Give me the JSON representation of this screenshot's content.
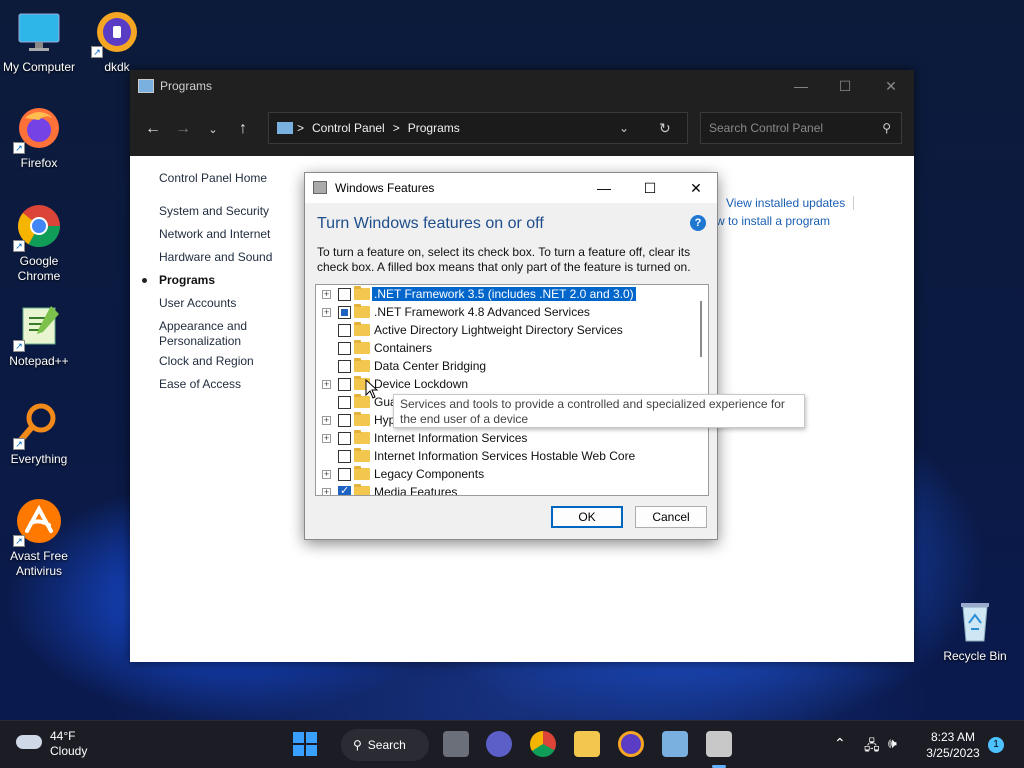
{
  "desktop": {
    "icons": [
      {
        "label": "My Computer",
        "icon": "monitor-icon"
      },
      {
        "label": "dkdk",
        "icon": "avast-secure-browser-icon"
      },
      {
        "label": "Firefox",
        "icon": "firefox-icon"
      },
      {
        "label": "Google Chrome",
        "icon": "chrome-icon"
      },
      {
        "label": "Notepad++",
        "icon": "notepadpp-icon"
      },
      {
        "label": "Everything",
        "icon": "everything-search-icon"
      },
      {
        "label": "Avast Free Antivirus",
        "icon": "avast-icon"
      },
      {
        "label": "Recycle Bin",
        "icon": "recycle-bin-icon"
      }
    ]
  },
  "control_panel": {
    "title": "Programs",
    "address": {
      "crumbs": [
        "Control Panel",
        "Programs"
      ],
      "separator": ">"
    },
    "search_placeholder": "Search Control Panel",
    "sidebar": {
      "home": "Control Panel Home",
      "items": [
        {
          "label": "System and Security"
        },
        {
          "label": "Network and Internet"
        },
        {
          "label": "Hardware and Sound"
        },
        {
          "label": "Programs",
          "active": true
        },
        {
          "label": "User Accounts"
        },
        {
          "label": "Appearance and Personalization"
        },
        {
          "label": "Clock and Region"
        },
        {
          "label": "Ease of Access"
        }
      ]
    },
    "links": {
      "view_updates": "View installed updates",
      "how_to_install": "w to install a program"
    }
  },
  "windows_features": {
    "title": "Windows Features",
    "heading": "Turn Windows features on or off",
    "description": "To turn a feature on, select its check box. To turn a feature off, clear its check box. A filled box means that only part of the feature is turned on.",
    "features": [
      {
        "label": ".NET Framework 3.5 (includes .NET 2.0 and 3.0)",
        "expandable": true,
        "state": "unchecked",
        "selected": true
      },
      {
        "label": ".NET Framework 4.8 Advanced Services",
        "expandable": true,
        "state": "partial"
      },
      {
        "label": "Active Directory Lightweight Directory Services",
        "expandable": false,
        "state": "unchecked"
      },
      {
        "label": "Containers",
        "expandable": false,
        "state": "unchecked"
      },
      {
        "label": "Data Center Bridging",
        "expandable": false,
        "state": "unchecked"
      },
      {
        "label": "Device Lockdown",
        "expandable": true,
        "state": "unchecked"
      },
      {
        "label": "Gua",
        "expandable": false,
        "state": "unchecked"
      },
      {
        "label": "Hyp",
        "expandable": true,
        "state": "unchecked"
      },
      {
        "label": "Internet Information Services",
        "expandable": true,
        "state": "unchecked"
      },
      {
        "label": "Internet Information Services Hostable Web Core",
        "expandable": false,
        "state": "unchecked"
      },
      {
        "label": "Legacy Components",
        "expandable": true,
        "state": "unchecked"
      },
      {
        "label": "Media Features",
        "expandable": true,
        "state": "checked"
      }
    ],
    "tooltip": "Services and tools to provide a controlled and specialized experience for the end user of a device",
    "ok_label": "OK",
    "cancel_label": "Cancel"
  },
  "taskbar": {
    "weather": {
      "temp": "44°F",
      "condition": "Cloudy"
    },
    "search_label": "Search",
    "clock": {
      "time": "8:23 AM",
      "date": "3/25/2023"
    },
    "notification_count": "1"
  }
}
